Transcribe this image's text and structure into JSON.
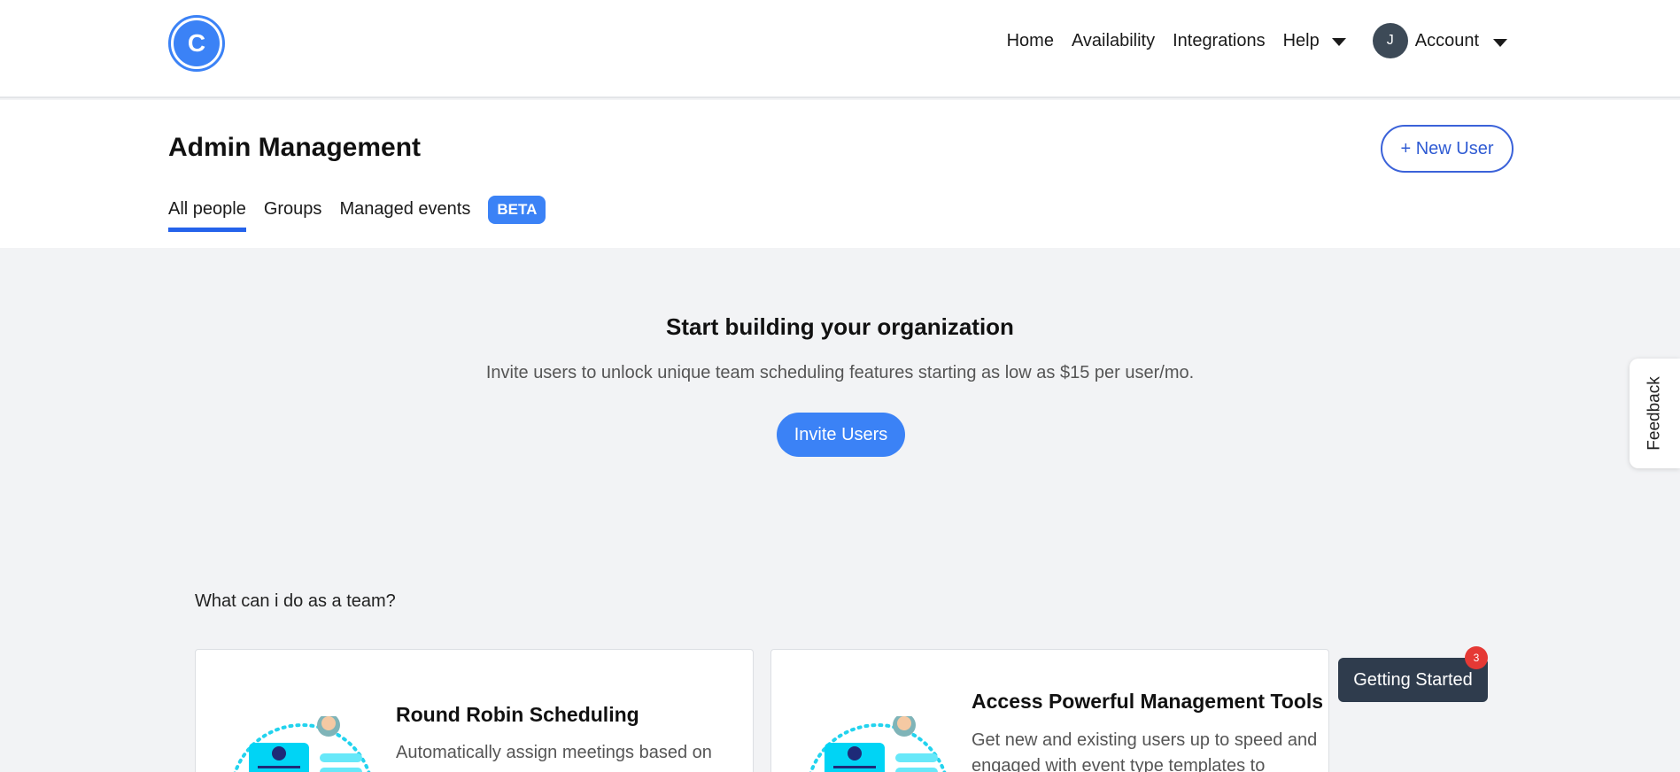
{
  "logo": {
    "letter": "C"
  },
  "nav": {
    "home": "Home",
    "availability": "Availability",
    "integrations": "Integrations",
    "help": "Help",
    "account_initial": "J",
    "account": "Account"
  },
  "header": {
    "title": "Admin Management",
    "new_user_button": "+ New User",
    "tabs": [
      {
        "label": "All people",
        "active": true
      },
      {
        "label": "Groups",
        "active": false
      },
      {
        "label": "Managed events",
        "active": false
      }
    ],
    "beta_badge": "BETA"
  },
  "hero": {
    "title": "Start building your organization",
    "subtitle": "Invite users to unlock unique team scheduling features starting as low as $15 per user/mo.",
    "invite_button": "Invite Users"
  },
  "feedback_tab": "Feedback",
  "team_section": {
    "question": "What can i do as a team?",
    "cards": [
      {
        "title": "Round Robin Scheduling",
        "description": "Automatically assign meetings based on"
      },
      {
        "title": "Access Powerful Management Tools",
        "description": "Get new and existing users up to speed and engaged with event type templates to"
      }
    ]
  },
  "getting_started": {
    "label": "Getting Started",
    "badge_count": "3"
  },
  "colors": {
    "accent": "#3b82f6",
    "dark": "#2f3c4d",
    "badge_red": "#e53935",
    "background": "#f2f3f5"
  }
}
